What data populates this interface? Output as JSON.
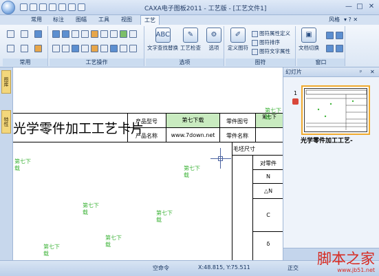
{
  "window": {
    "title": "CAXA电子图板2011 - 工艺版 - [工艺文件1]",
    "minimize": "—",
    "maximize": "□",
    "close": "✕"
  },
  "menu": {
    "tabs": [
      {
        "label": "常用"
      },
      {
        "label": "标注"
      },
      {
        "label": "图幅"
      },
      {
        "label": "工具"
      },
      {
        "label": "视图"
      },
      {
        "label": "工艺"
      }
    ],
    "active_tab": "工艺",
    "style_label": "风格",
    "right_icons": "▾ ? ✕"
  },
  "ribbon": {
    "groups": {
      "common": "常用",
      "process_ops": "工艺操作",
      "options": "选项",
      "graphics": "图符",
      "window": "窗口"
    },
    "buttons": {
      "text_find_replace": "文字查找替换",
      "process_check": "工艺检查",
      "options": "选项",
      "define_graphic": "定义图符",
      "graphic_props_def": "图符属性定义",
      "graphic_sort": "图符排序",
      "graphic_text_props": "图符文字属性",
      "doc_switch": "文档切换"
    }
  },
  "left_tabs": [
    "图库",
    "特性"
  ],
  "document": {
    "card_title": "光学零件加工工艺卡片",
    "header_cells": {
      "product_model_label": "产品型号",
      "product_model_value": "第七下载",
      "part_drawing_label": "零件图号",
      "part_drawing_value": "第七下",
      "product_name_label": "产品名称",
      "product_name_value": "www.7down.net",
      "part_name_label": "零件名称",
      "blank_size_label": "毛坯尺寸",
      "to_part_label": "对零件",
      "row_n": "N",
      "row_delta_n": "△N",
      "row_c": "C",
      "row_delta": "δ"
    },
    "watermarks": [
      "第七下\n载",
      "第七下\n载",
      "第七下\n载",
      "第七下\n载",
      "第七下\n载",
      "第七下\n载",
      "第七下\n载"
    ]
  },
  "slides_panel": {
    "title": "幻灯片",
    "pin": "ᵖ",
    "close": "✕",
    "slide_number": "1",
    "thumb_caption": "光学零件加工工艺-"
  },
  "statusbar": {
    "empty_command": "空命令",
    "coordinates": "X:48.815, Y:75.511",
    "mode_label": "正交"
  },
  "brand": {
    "name": "脚本之家",
    "url": "www.jb51.net"
  },
  "colors": {
    "accent": "#3a78c8",
    "watermark_green": "#3fb43a",
    "brand_red": "#d7281f",
    "cell_green": "#c9ebc0",
    "thumb_border": "#f0a92b"
  }
}
